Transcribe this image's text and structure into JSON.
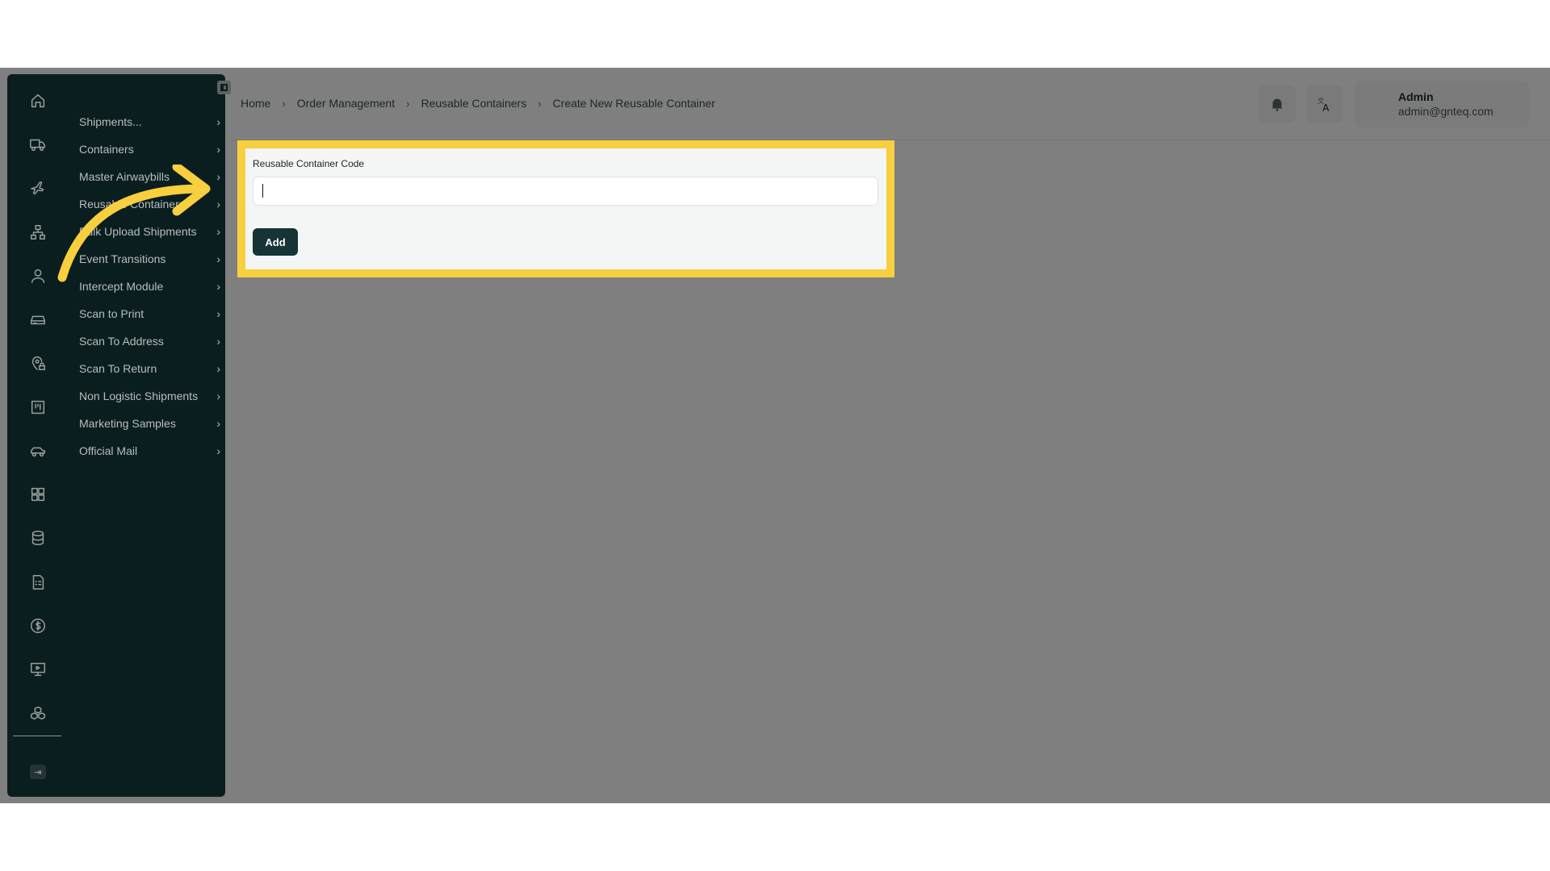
{
  "breadcrumb": {
    "items": [
      "Home",
      "Order Management",
      "Reusable Containers",
      "Create New Reusable Container"
    ],
    "separator": "›"
  },
  "sidebar": {
    "rail_icons": [
      "home-icon",
      "truck-icon",
      "airplane-icon",
      "network-icon",
      "user-icon",
      "scanner-icon",
      "location-lock-icon",
      "kanban-icon",
      "car-icon",
      "grid-icon",
      "database-icon",
      "document-list-icon",
      "dollar-icon",
      "presentation-icon",
      "boxes-icon",
      "logout-icon"
    ],
    "menu_items": [
      {
        "label": "Shipments..."
      },
      {
        "label": "Containers"
      },
      {
        "label": "Master Airwaybills"
      },
      {
        "label": "Reusable Containers"
      },
      {
        "label": "Bulk Upload Shipments"
      },
      {
        "label": "Event Transitions"
      },
      {
        "label": "Intercept Module"
      },
      {
        "label": "Scan to Print"
      },
      {
        "label": "Scan To Address"
      },
      {
        "label": "Scan To Return"
      },
      {
        "label": "Non Logistic Shipments"
      },
      {
        "label": "Marketing Samples"
      },
      {
        "label": "Official Mail"
      }
    ],
    "chevron": "›"
  },
  "user": {
    "name": "Admin",
    "email": "admin@gnteq.com"
  },
  "form": {
    "label": "Reusable Container Code",
    "value": "",
    "button": "Add"
  },
  "colors": {
    "sidebar_bg": "#0b1e1f",
    "overlay": "#7f7f7f",
    "highlight": "#f7cf3f",
    "primary_button": "#163436"
  }
}
